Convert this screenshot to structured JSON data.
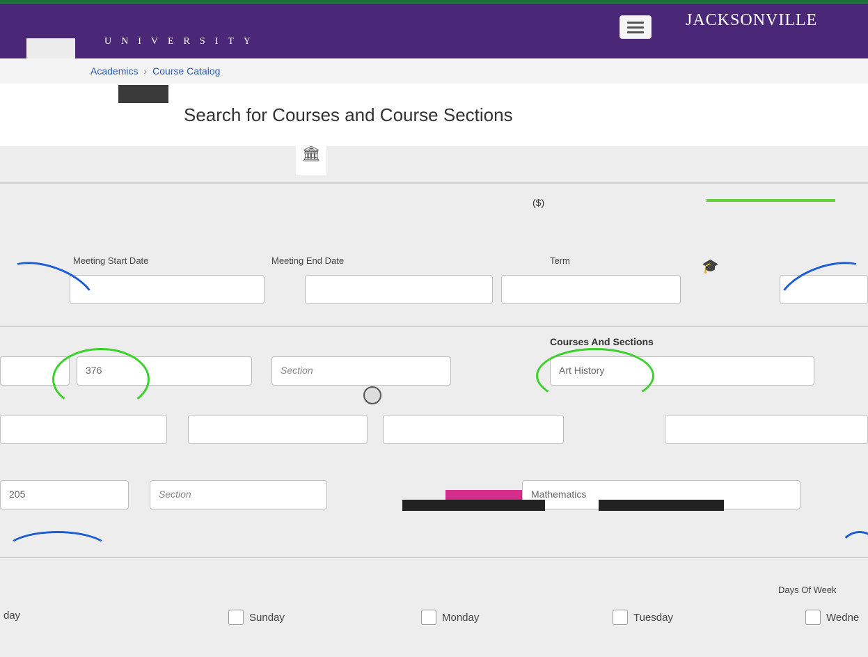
{
  "header": {
    "university_word": "UNIVERSITY",
    "brand": "JACKSONVILLE",
    "menu_icon": "hamburger-icon"
  },
  "breadcrumb": {
    "items": [
      "Academics",
      "Course Catalog"
    ]
  },
  "page": {
    "title": "Search for Courses and Course Sections"
  },
  "dates": {
    "start_label": "Meeting Start Date",
    "end_label": "Meeting End Date",
    "term_label": "Term"
  },
  "subjects": {
    "courses_label": "Courses And Sections",
    "row1": {
      "course": "376",
      "section_placeholder": "Section",
      "subject": "Art History"
    },
    "row2": {
      "course": "205",
      "section_placeholder": "Section",
      "subject": "Mathematics"
    }
  },
  "days": {
    "label": "Days Of Week",
    "items": [
      "day",
      "Sunday",
      "Monday",
      "Tuesday",
      "Wedne"
    ]
  },
  "colors": {
    "header_purple": "#4b2778",
    "accent_green": "#5fcf32",
    "accent_blue": "#1a5cd6",
    "accent_pink": "#d62d8a"
  }
}
